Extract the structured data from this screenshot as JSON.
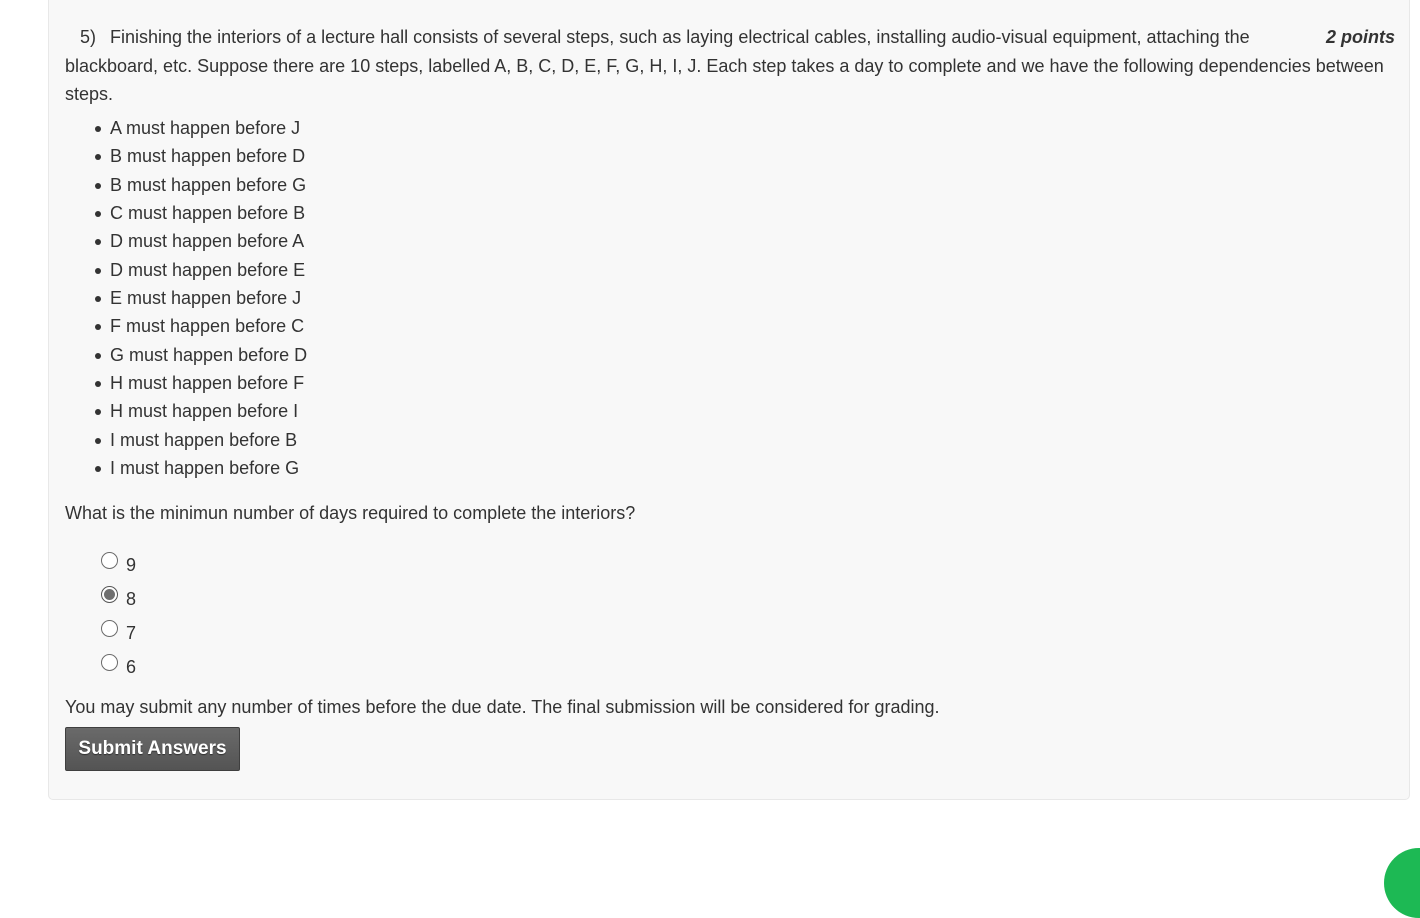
{
  "question": {
    "number": "5)",
    "text": "Finishing the interiors of a lecture hall consists of several steps, such as laying electrical cables, installing audio-visual equipment, attaching the blackboard, etc. Suppose there are 10 steps, labelled A, B, C, D, E, F, G, H, I, J. Each step takes a day to complete and we have the following dependencies between steps.",
    "points": "2 points",
    "dependencies": [
      "A must happen before J",
      "B must happen before D",
      "B must happen before G",
      "C must happen before B",
      "D must happen before A",
      "D must happen before E",
      "E must happen before J",
      "F must happen before C",
      "G must happen before D",
      "H must happen before F",
      "H must happen before I",
      "I must happen before B",
      "I must happen before G"
    ],
    "prompt": "What is the minimun number of days required to complete the interiors?",
    "options": [
      {
        "label": "9",
        "checked": false
      },
      {
        "label": "8",
        "checked": true
      },
      {
        "label": "7",
        "checked": false
      },
      {
        "label": "6",
        "checked": false
      }
    ]
  },
  "footer": {
    "note": "You may submit any number of times before the due date. The final submission will be considered for grading.",
    "submit_label": "Submit Answers"
  },
  "colors": {
    "panel_bg": "#f8f8f8",
    "text": "#333333",
    "button_bg": "#5e5e5e",
    "fab": "#1db954"
  }
}
